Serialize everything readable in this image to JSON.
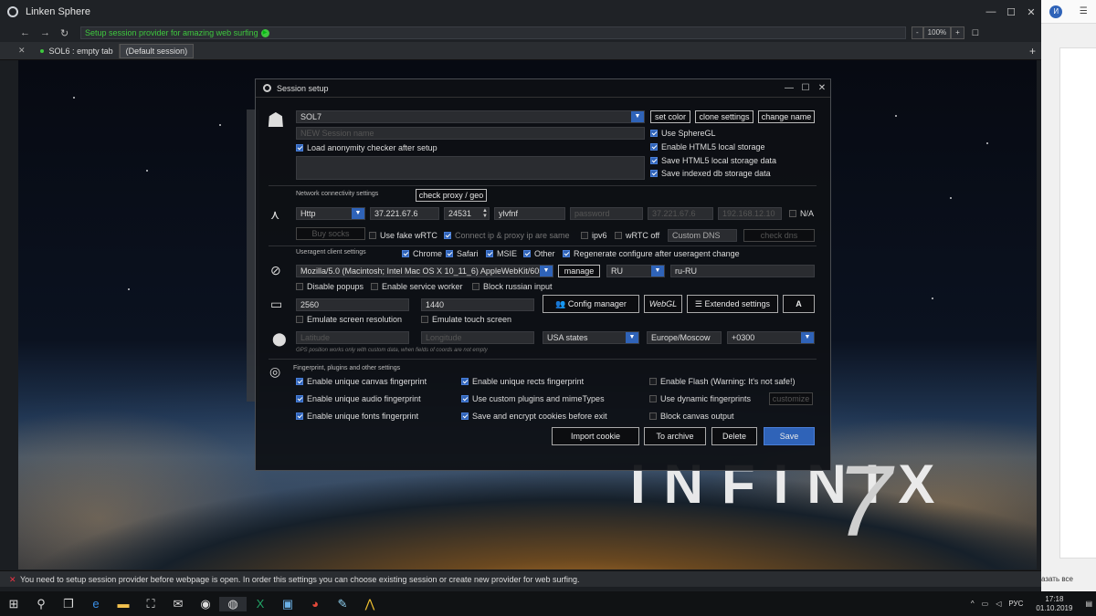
{
  "window": {
    "title": "Linken Sphere",
    "min": "—",
    "max": "☐",
    "close": "✕"
  },
  "nav": {
    "url_text": "Setup session provider for amazing web surfing",
    "zoom_minus": "-",
    "zoom_value": "100%",
    "zoom_plus": "+",
    "bookmark_btn": "☐"
  },
  "tabs": {
    "close_glyph": "✕",
    "items": [
      {
        "label": "SOL6 : empty tab"
      },
      {
        "label": "(Default session)"
      }
    ],
    "add": "+"
  },
  "background": {
    "brand_text": "INFINIX",
    "brand_number": "7"
  },
  "dialog": {
    "title": "Session setup",
    "session_name": "SOL7",
    "new_session_placeholder": "NEW Session name",
    "load_checker_label": "Load anonymity checker after setup",
    "set_color": "set color",
    "clone_settings": "clone settings",
    "change_name": "change name",
    "right_checks": [
      {
        "label": "Use SphereGL",
        "checked": true
      },
      {
        "label": "Enable HTML5 local storage",
        "checked": true
      },
      {
        "label": "Save HTML5 local storage data",
        "checked": true
      },
      {
        "label": "Save indexed db storage data",
        "checked": true
      }
    ],
    "network": {
      "section": "Network connectivity settings",
      "check_proxy": "check proxy / geo",
      "protocol": "Http",
      "ip": "37.221.67.6",
      "port": "24531",
      "login": "ylvfnf",
      "password_placeholder": "password",
      "ext_ip": "37.221.67.6",
      "local_ip": "192.168.12.10",
      "na_label": "N/A",
      "buy_socks": "Buy socks",
      "fake_webrtc": "Use fake wRTC",
      "connect_same": "Connect ip & proxy ip are same",
      "ipv6": "ipv6",
      "webrtc_off": "wRTC off",
      "custom_dns": "Custom DNS",
      "check_dns": "check dns"
    },
    "useragent": {
      "section": "Useragent client settings",
      "browsers": [
        {
          "label": "Chrome",
          "checked": true
        },
        {
          "label": "Safari",
          "checked": true
        },
        {
          "label": "MSIE",
          "checked": true
        },
        {
          "label": "Other",
          "checked": true
        }
      ],
      "regenerate": "Regenerate configure after useragent change",
      "ua_value": "Mozilla/5.0 (Macintosh; Intel Mac OS X 10_11_6) AppleWebKit/605",
      "manage": "manage",
      "lang": "RU",
      "locale": "ru-RU",
      "disable_popups": "Disable popups",
      "service_worker": "Enable service worker",
      "block_russian": "Block russian input"
    },
    "screen": {
      "width": "2560",
      "height": "1440",
      "config_manager": "Config manager",
      "webgl": "WebGL",
      "extended": "Extended settings",
      "font_btn": "A",
      "emulate_res": "Emulate screen resolution",
      "emulate_touch": "Emulate touch screen"
    },
    "geo": {
      "lat_placeholder": "Latitude",
      "lon_placeholder": "Longitude",
      "hint": "GPS position works only with custom data, when fields of coords are not empty",
      "region": "USA states",
      "timezone": "Europe/Moscow",
      "offset": "+0300"
    },
    "fingerprint": {
      "section": "Fingerprint, plugins and other settings",
      "col1": [
        {
          "label": "Enable unique canvas fingerprint",
          "checked": true
        },
        {
          "label": "Enable unique audio fingerprint",
          "checked": true
        },
        {
          "label": "Enable unique fonts fingerprint",
          "checked": true
        }
      ],
      "col2": [
        {
          "label": "Enable unique rects fingerprint",
          "checked": true
        },
        {
          "label": "Use custom plugins and mimeTypes",
          "checked": true
        },
        {
          "label": "Save and encrypt cookies before exit",
          "checked": true
        }
      ],
      "col3": [
        {
          "label": "Enable Flash (Warning: It's not safe!)",
          "checked": false
        },
        {
          "label": "Use dynamic fingerprints",
          "checked": false
        },
        {
          "label": "Block canvas output",
          "checked": false
        }
      ],
      "customize": "customize"
    },
    "footer": {
      "import_cookie": "Import cookie",
      "to_archive": "To archive",
      "delete": "Delete",
      "save": "Save"
    }
  },
  "statusbar": {
    "message": "You need to setup session provider before webpage is open. In order this settings you can choose existing session or create new provider for web surfing."
  },
  "right_fragment": {
    "avatar": "И",
    "text": "азать все"
  },
  "taskbar": {
    "lang": "РУС",
    "time": "17:18",
    "date": "01.10.2019"
  }
}
